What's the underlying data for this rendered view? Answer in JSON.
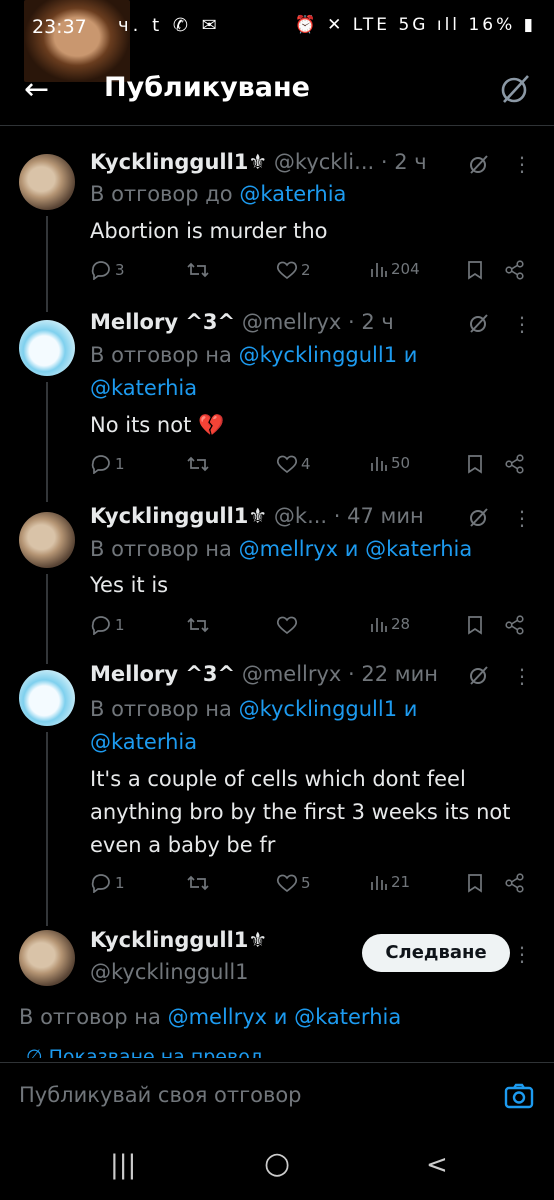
{
  "status_bar": {
    "time": "23:37",
    "left_icons": "ч. t ✆ ✉",
    "right_icons": "⏰ ✕ LTE 5G ıll",
    "battery": "16%"
  },
  "header": {
    "title": "Публикуване"
  },
  "tweets": [
    {
      "display_name": "Kycklinggull1⚜",
      "handle": "@kyckli...",
      "time": "· 2 ч",
      "replying_prefix": "В отговор до ",
      "replying_to": [
        "@katerhia"
      ],
      "text": "Abortion is murder tho",
      "replies": "3",
      "reposts": "",
      "likes": "2",
      "views": "204"
    },
    {
      "display_name": "Mellory ^3^",
      "handle": "@mellryx",
      "time": "· 2 ч",
      "replying_prefix": "В отговор на ",
      "replying_to": [
        "@kycklinggull1",
        "@katerhia"
      ],
      "replying_joiner": " и",
      "text": "No its not 💔",
      "replies": "1",
      "reposts": "",
      "likes": "4",
      "views": "50"
    },
    {
      "display_name": "Kycklinggull1⚜",
      "handle": "@k...",
      "time": "· 47 мин",
      "replying_prefix": "В отговор на ",
      "replying_to": [
        "@mellryx",
        "@katerhia"
      ],
      "replying_joiner": " и ",
      "text": "Yes it is",
      "replies": "1",
      "reposts": "",
      "likes": "",
      "views": "28"
    },
    {
      "display_name": "Mellory ^3^",
      "handle": "@mellryx",
      "time": "· 22 мин",
      "replying_prefix": "В отговор на ",
      "replying_to": [
        "@kycklinggull1",
        "@katerhia"
      ],
      "replying_joiner": " и",
      "text": "It's a couple of cells which dont feel anything bro by the first 3 weeks its not even a baby be fr",
      "replies": "1",
      "reposts": "",
      "likes": "5",
      "views": "21"
    }
  ],
  "focused": {
    "display_name": "Kycklinggull1⚜",
    "handle": "@kycklinggull1",
    "follow_label": "Следване",
    "replying_prefix": "В отговор на ",
    "replying_to": [
      "@mellryx",
      "@katerhia"
    ],
    "replying_joiner": " и ",
    "translate": "Показване на превод"
  },
  "reply_bar": {
    "placeholder": "Публикувай своя отговор"
  },
  "nav": {
    "recents": "|||",
    "home": "○",
    "back": "<"
  },
  "colors": {
    "accent": "#1d9bf0",
    "secondary_text": "#71767b",
    "primary_text": "#e7e9ea",
    "background": "#000000",
    "divider": "#2f3336"
  }
}
